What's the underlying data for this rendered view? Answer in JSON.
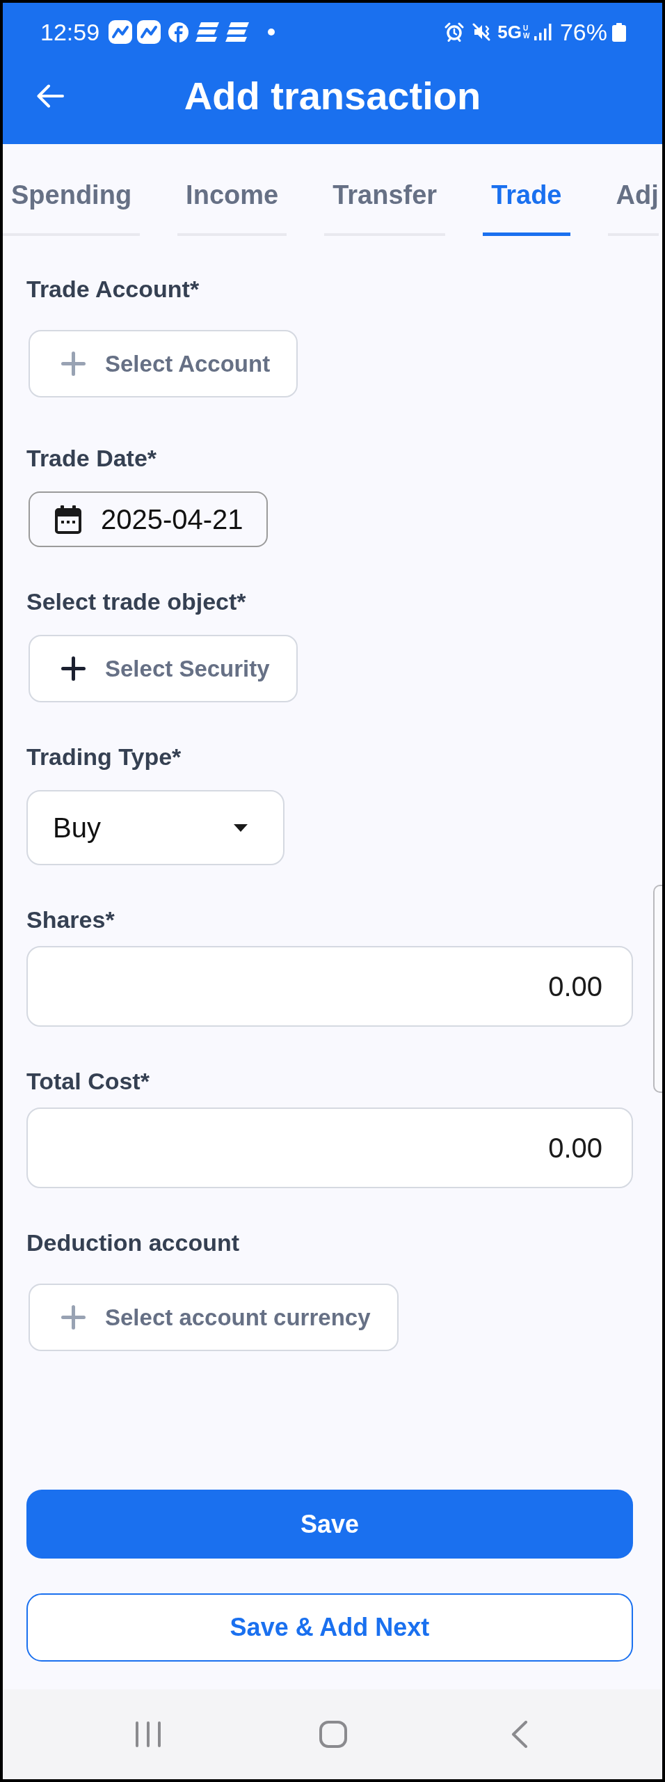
{
  "status_bar": {
    "time": "12:59",
    "network": "5G",
    "network_badge": "UW",
    "battery": "76%"
  },
  "app_bar": {
    "title": "Add transaction"
  },
  "tabs": [
    {
      "label": "Spending",
      "selected": false
    },
    {
      "label": "Income",
      "selected": false
    },
    {
      "label": "Transfer",
      "selected": false
    },
    {
      "label": "Trade",
      "selected": true
    },
    {
      "label": "Adj",
      "selected": false
    }
  ],
  "form": {
    "fields": [
      {
        "kind": "account_picker",
        "label": "Trade Account*",
        "text": "Select Account"
      },
      {
        "kind": "date",
        "label": "Trade Date*",
        "value": "2025-04-21"
      },
      {
        "kind": "security_picker",
        "label": "Select trade object*",
        "text": "Select Security"
      },
      {
        "kind": "dropdown",
        "label": "Trading Type*",
        "value": "Buy"
      },
      {
        "kind": "number",
        "label": "Shares*",
        "value": "0.00"
      },
      {
        "kind": "number",
        "label": "Total Cost*",
        "value": "0.00"
      },
      {
        "kind": "account_picker",
        "label": "Deduction account",
        "text": "Select account currency"
      }
    ]
  },
  "buttons": [
    {
      "kind": "primary",
      "label": "Save"
    },
    {
      "kind": "outline",
      "label": "Save & Add Next"
    }
  ]
}
